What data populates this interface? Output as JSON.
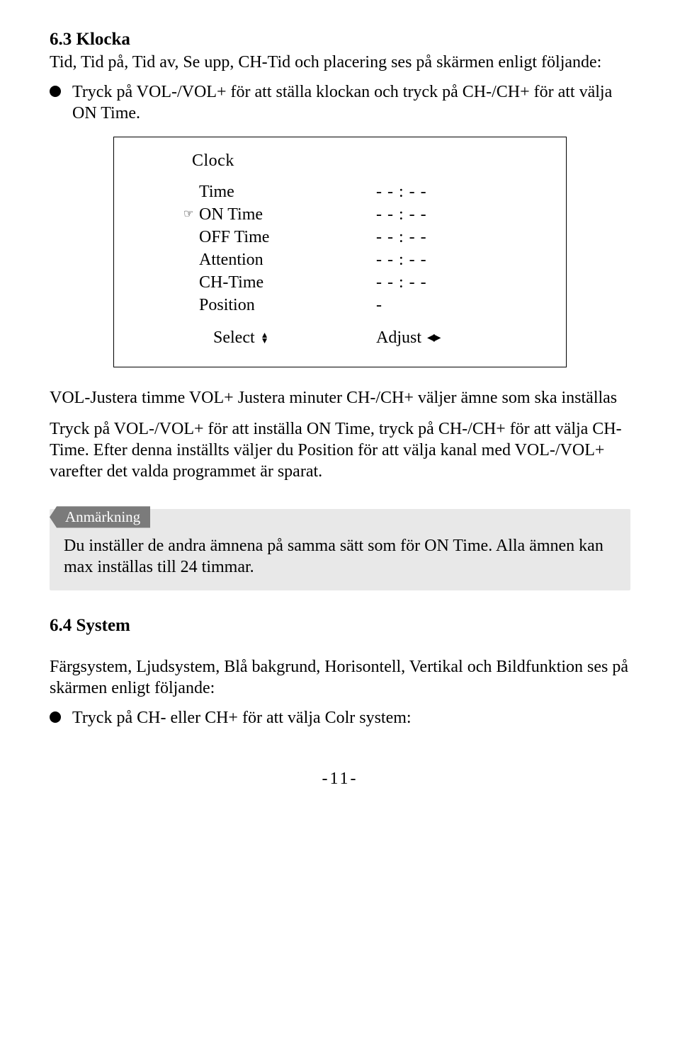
{
  "section63": {
    "heading": "6.3 Klocka",
    "intro": "Tid, Tid på, Tid av,  Se upp, CH-Tid och placering ses på skärmen enligt följande:",
    "bullet": "Tryck på VOL-/VOL+ för att ställa klockan och tryck på CH-/CH+ för att välja ON Time."
  },
  "clock": {
    "title": "Clock",
    "rows": [
      {
        "label": "Time",
        "value": "- - : - -",
        "hand": false
      },
      {
        "label": "ON Time",
        "value": "- - : - -",
        "hand": true
      },
      {
        "label": "OFF Time",
        "value": "- - : - -",
        "hand": false
      },
      {
        "label": "Attention",
        "value": "- - : - -",
        "hand": false
      },
      {
        "label": "CH-Time",
        "value": "- - : - -",
        "hand": false
      },
      {
        "label": "Position",
        "value": "-",
        "hand": false
      }
    ],
    "select_label": "Select",
    "adjust_label": "Adjust"
  },
  "midtext": {
    "p1": "VOL-Justera timme  VOL+ Justera minuter   CH-/CH+ väljer ämne som ska inställas",
    "p2": "Tryck på VOL-/VOL+ för att inställa ON Time, tryck på CH-/CH+ för att välja CH-Time. Efter denna inställts väljer du Position för att välja kanal med VOL-/VOL+  varefter det valda programmet är sparat."
  },
  "note": {
    "label": "Anmärkning",
    "body": "Du inställer de andra ämnena på samma sätt som för ON Time. Alla ämnen kan max inställas till 24 timmar."
  },
  "section64": {
    "heading": "6.4 System",
    "intro": "Färgsystem, Ljudsystem, Blå bakgrund, Horisontell,  Vertikal och Bildfunktion ses på skärmen enligt följande:",
    "bullet": "Tryck på CH- eller CH+ för att välja Colr system:"
  },
  "page_number": "-11-"
}
